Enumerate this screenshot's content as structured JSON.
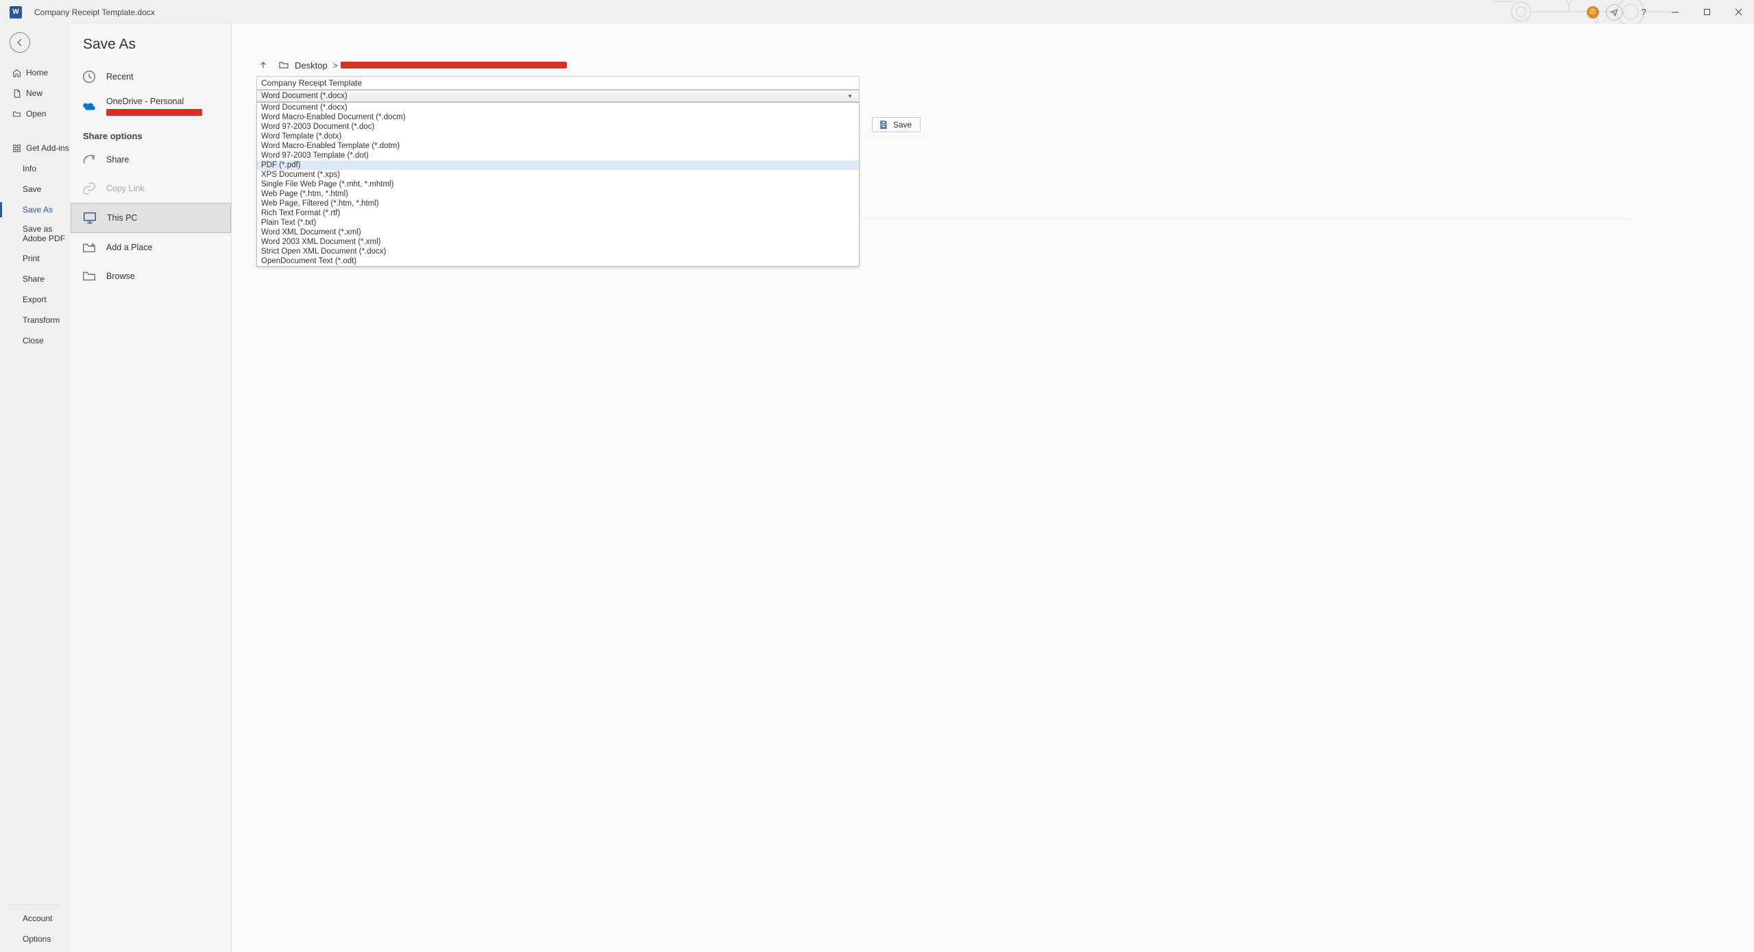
{
  "titlebar": {
    "app_glyph": "W",
    "doc_title": "Company Receipt Template.docx"
  },
  "leftnav": {
    "home": "Home",
    "new": "New",
    "open": "Open",
    "get_addins": "Get Add-ins",
    "info": "Info",
    "save": "Save",
    "save_as": "Save As",
    "save_as_pdf": "Save as Adobe PDF",
    "print": "Print",
    "share": "Share",
    "export": "Export",
    "transform": "Transform",
    "close": "Close",
    "account": "Account",
    "options": "Options"
  },
  "midcol": {
    "title": "Save As",
    "recent": "Recent",
    "onedrive": "OneDrive - Personal",
    "share_options": "Share options",
    "share": "Share",
    "copy_link": "Copy Link",
    "this_pc": "This PC",
    "add_place": "Add a Place",
    "browse": "Browse"
  },
  "mainpane": {
    "breadcrumb_root": "Desktop",
    "filename": "Company Receipt Template",
    "selected_type": "Word Document (*.docx)",
    "save_label": "Save",
    "file_types": [
      "Word Document (*.docx)",
      "Word Macro-Enabled Document (*.docm)",
      "Word 97-2003 Document (*.doc)",
      "Word Template (*.dotx)",
      "Word Macro-Enabled Template (*.dotm)",
      "Word 97-2003 Template (*.dot)",
      "PDF (*.pdf)",
      "XPS Document (*.xps)",
      "Single File Web Page (*.mht, *.mhtml)",
      "Web Page (*.htm, *.html)",
      "Web Page, Filtered (*.htm, *.html)",
      "Rich Text Format (*.rtf)",
      "Plain Text (*.txt)",
      "Word XML Document (*.xml)",
      "Word 2003 XML Document (*.xml)",
      "Strict Open XML Document (*.docx)",
      "OpenDocument Text (*.odt)"
    ]
  }
}
